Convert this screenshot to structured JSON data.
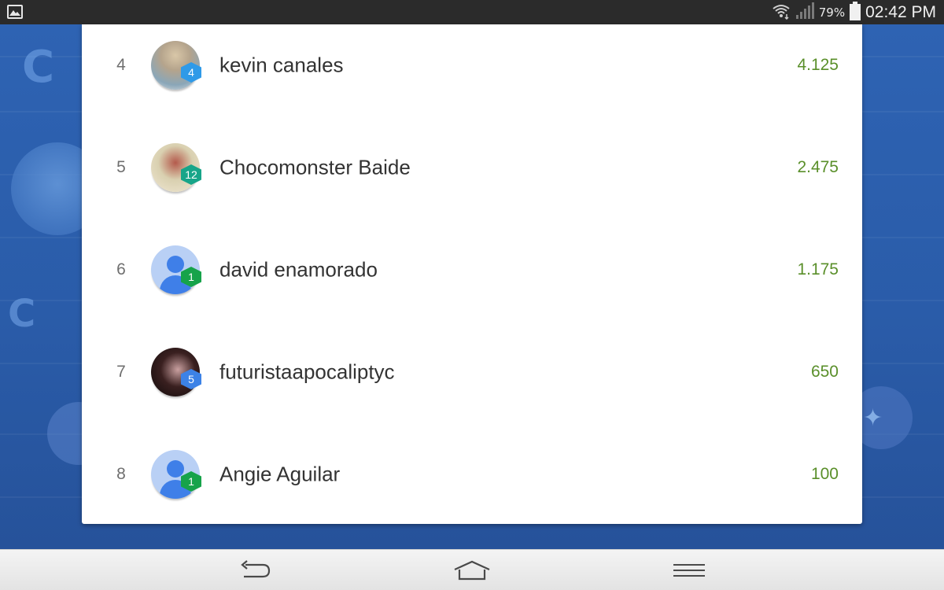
{
  "status_bar": {
    "battery_percent": "79%",
    "time": "02:42 PM"
  },
  "leaderboard": {
    "rows": [
      {
        "rank": "4",
        "name": "kevin canales",
        "level": "4",
        "score": "4.125",
        "avatar": "photo",
        "badge_color": "#2f9ae8"
      },
      {
        "rank": "5",
        "name": "Chocomonster Baide",
        "level": "12",
        "score": "2.475",
        "avatar": "photo",
        "badge_color": "#17a589"
      },
      {
        "rank": "6",
        "name": "david enamorado",
        "level": "1",
        "score": "1.175",
        "avatar": "default-person",
        "badge_color": "#16a34a"
      },
      {
        "rank": "7",
        "name": "futuristaapocaliptyc",
        "level": "5",
        "score": "650",
        "avatar": "photo",
        "badge_color": "#3c82e6"
      },
      {
        "rank": "8",
        "name": "Angie Aguilar",
        "level": "1",
        "score": "100",
        "avatar": "default-person",
        "badge_color": "#16a34a"
      }
    ]
  },
  "nav_bar": {
    "icons": [
      "back-icon",
      "home-icon",
      "menu-icon"
    ]
  }
}
